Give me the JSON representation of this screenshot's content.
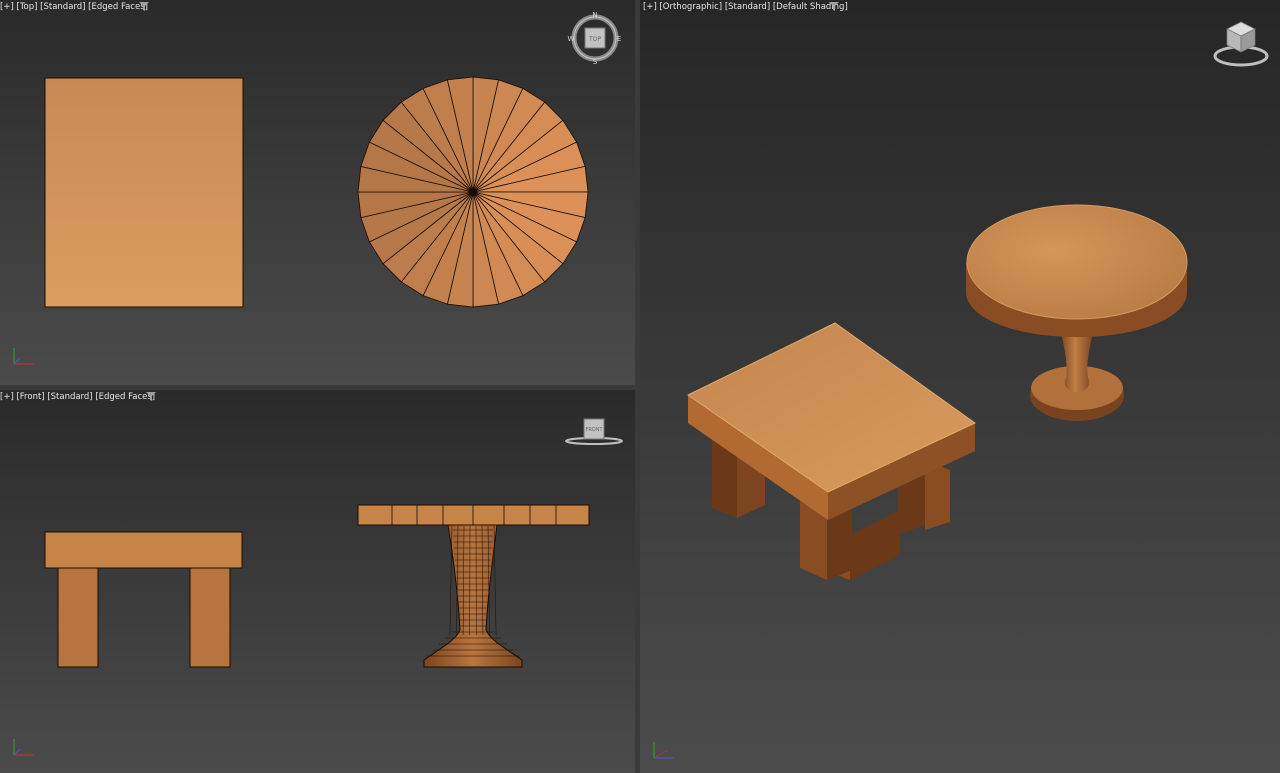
{
  "viewports": {
    "top": {
      "label": {
        "plus": "[+]",
        "view": "[Top]",
        "preset": "[Standard]",
        "shading": "[Edged Faces]"
      },
      "viewcube": {
        "face": "TOP",
        "compass": {
          "n": "N",
          "s": "S",
          "e": "E",
          "w": "W"
        }
      }
    },
    "front": {
      "label": {
        "plus": "[+]",
        "view": "[Front]",
        "preset": "[Standard]",
        "shading": "[Edged Faces]"
      },
      "viewcube": {
        "face": "FRONT"
      }
    },
    "ortho": {
      "label": {
        "plus": "[+]",
        "view": "[Orthographic]",
        "preset": "[Standard]",
        "shading": "[Default Shading]"
      }
    }
  },
  "colors": {
    "viewport_bg_top": "#2c2c2c",
    "viewport_bg_bottom": "#4a4a4a",
    "wood_light": "#d8995c",
    "wood_mid": "#c47e45",
    "wood_dark": "#7a4521",
    "edge": "#1a0d04",
    "label_text": "#e8e8e8"
  },
  "icons": [
    "filter-icon",
    "viewcube-icon",
    "axis-tripod-icon"
  ]
}
